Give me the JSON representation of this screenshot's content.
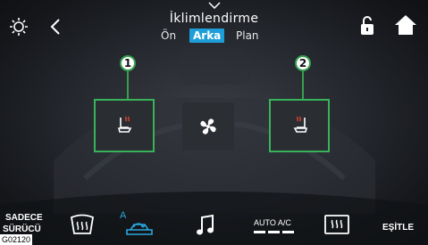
{
  "header": {
    "title": "İklimlendirme",
    "tabs": [
      {
        "label": "Ön",
        "active": false
      },
      {
        "label": "Arka",
        "active": true
      },
      {
        "label": "Plan",
        "active": false
      }
    ]
  },
  "icons": {
    "brightness": "brightness-icon",
    "back": "back-chevron-icon",
    "collapse": "chevron-down-icon",
    "lock": "unlocked-padlock-icon",
    "home": "home-icon",
    "seat_left": "heated-seat-icon",
    "fan": "fan-icon",
    "seat_right": "heated-seat-icon",
    "windshield": "front-defrost-icon",
    "recirc": "auto-air-recirculation-icon",
    "music": "music-note-icon",
    "rear_defrost": "rear-defrost-icon"
  },
  "callouts": [
    "1",
    "2"
  ],
  "bottom": {
    "driver_only_line1": "SADECE",
    "driver_only_line2": "SÜRÜCÜ",
    "recirc_badge": "A",
    "auto_ac_label": "AUTO A/C",
    "sync_label": "EŞİTLE"
  },
  "figure_code": "G02120",
  "colors": {
    "accent_tab": "#1e9ed8",
    "highlight": "#39b35a",
    "recirc_icon": "#29a6e0"
  }
}
